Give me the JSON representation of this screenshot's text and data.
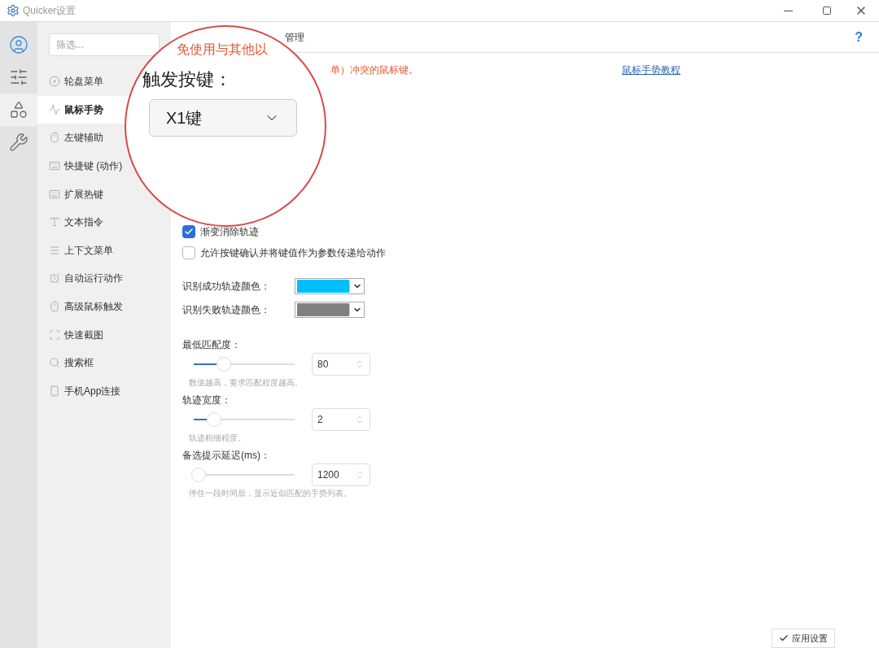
{
  "window": {
    "title": "Quicker设置"
  },
  "rail": [
    {
      "kind": "user",
      "selected": false
    },
    {
      "kind": "sliders",
      "selected": false
    },
    {
      "kind": "shapes",
      "selected": true
    },
    {
      "kind": "tools",
      "selected": false
    }
  ],
  "filter": {
    "placeholder": "筛选..."
  },
  "nav": [
    {
      "label": "轮盘菜单",
      "kind": "wheel",
      "selected": false
    },
    {
      "label": "鼠标手势",
      "kind": "wave",
      "selected": true
    },
    {
      "label": "左键辅助",
      "kind": "mouse",
      "selected": false
    },
    {
      "label": "快捷键 (动作)",
      "kind": "keyboard",
      "selected": false
    },
    {
      "label": "扩展热键",
      "kind": "keyboard",
      "selected": false
    },
    {
      "label": "文本指令",
      "kind": "text",
      "selected": false
    },
    {
      "label": "上下文菜单",
      "kind": "menu",
      "selected": false
    },
    {
      "label": "自动运行动作",
      "kind": "alarm",
      "selected": false
    },
    {
      "label": "高级鼠标触发",
      "kind": "mouse",
      "selected": false
    },
    {
      "label": "快速截图",
      "kind": "crop",
      "selected": false
    },
    {
      "label": "搜索框",
      "kind": "search",
      "selected": false
    },
    {
      "label": "手机App连接",
      "kind": "phone",
      "selected": false
    }
  ],
  "header": {
    "title": "管理",
    "help": "?"
  },
  "warning": "单）冲突的鼠标键。",
  "tutorial_link": "鼠标手势教程",
  "magnifier": {
    "heading": "免使用与其他以",
    "label": "触发按键：",
    "value": "X1键"
  },
  "checkboxes": [
    {
      "label": "渐变消除轨迹",
      "checked": true
    },
    {
      "label": "允许按键确认并将键值作为参数传递给动作",
      "checked": false
    }
  ],
  "colors": [
    {
      "label": "识别成功轨迹颜色：",
      "color": "#00bfff"
    },
    {
      "label": "识别失败轨迹颜色：",
      "color": "#808080"
    }
  ],
  "sliders": [
    {
      "label": "最低匹配度：",
      "level": 0.3,
      "value": "80",
      "hint": "数值越高，要求匹配程度越高。"
    },
    {
      "label": "轨迹宽度：",
      "level": 0.2,
      "value": "2",
      "hint": "轨迹粗细程度。"
    },
    {
      "label": "备选提示延迟(ms)：",
      "level": 0.05,
      "value": "1200",
      "hint": "停住一段时间后，显示近似匹配的手势列表。"
    }
  ],
  "apply_button": "应用设置"
}
